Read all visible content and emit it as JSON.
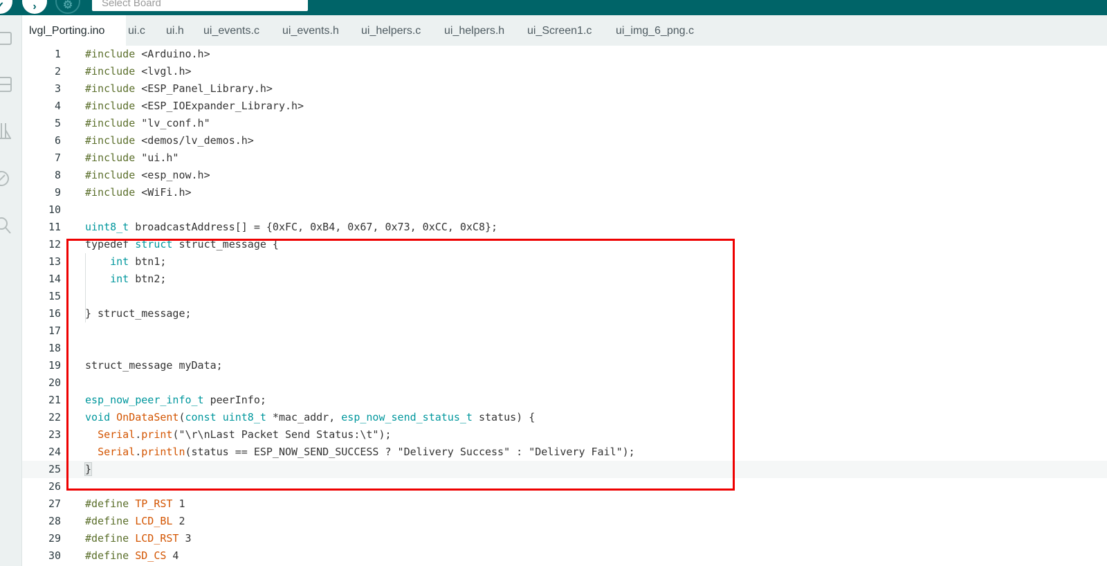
{
  "toolbar": {
    "board_selector_placeholder": "Select Board",
    "verify_icon": "check-icon",
    "upload_icon": "arrow-right-icon",
    "debug_icon": "debug-icon"
  },
  "sidebar": {
    "items": [
      {
        "icon": "folder-icon"
      },
      {
        "icon": "boards-manager-icon"
      },
      {
        "icon": "library-manager-icon"
      },
      {
        "icon": "debug-icon"
      },
      {
        "icon": "search-icon"
      }
    ]
  },
  "tabs": [
    {
      "label": "lvgl_Porting.ino",
      "active": true
    },
    {
      "label": "ui.c"
    },
    {
      "label": "ui.h"
    },
    {
      "label": "ui_events.c"
    },
    {
      "label": "ui_events.h"
    },
    {
      "label": "ui_helpers.c"
    },
    {
      "label": "ui_helpers.h"
    },
    {
      "label": "ui_Screen1.c"
    },
    {
      "label": "ui_img_6_png.c"
    }
  ],
  "editor": {
    "current_line": "25",
    "lines": [
      {
        "n": "1",
        "text": "#include <Arduino.h>"
      },
      {
        "n": "2",
        "text": "#include <lvgl.h>"
      },
      {
        "n": "3",
        "text": "#include <ESP_Panel_Library.h>"
      },
      {
        "n": "4",
        "text": "#include <ESP_IOExpander_Library.h>"
      },
      {
        "n": "5",
        "text": "#include \"lv_conf.h\""
      },
      {
        "n": "6",
        "text": "#include <demos/lv_demos.h>"
      },
      {
        "n": "7",
        "text": "#include \"ui.h\""
      },
      {
        "n": "8",
        "text": "#include <esp_now.h>"
      },
      {
        "n": "9",
        "text": "#include <WiFi.h>"
      },
      {
        "n": "10",
        "text": ""
      },
      {
        "n": "11",
        "text": "uint8_t broadcastAddress[] = {0xFC, 0xB4, 0x67, 0x73, 0xCC, 0xC8};"
      },
      {
        "n": "12",
        "text": "typedef struct struct_message {"
      },
      {
        "n": "13",
        "text": "    int btn1;"
      },
      {
        "n": "14",
        "text": "    int btn2;"
      },
      {
        "n": "15",
        "text": ""
      },
      {
        "n": "16",
        "text": "} struct_message;"
      },
      {
        "n": "17",
        "text": ""
      },
      {
        "n": "18",
        "text": ""
      },
      {
        "n": "19",
        "text": "struct_message myData;"
      },
      {
        "n": "20",
        "text": ""
      },
      {
        "n": "21",
        "text": "esp_now_peer_info_t peerInfo;"
      },
      {
        "n": "22",
        "text": "void OnDataSent(const uint8_t *mac_addr, esp_now_send_status_t status) {"
      },
      {
        "n": "23",
        "text": "  Serial.print(\"\\r\\nLast Packet Send Status:\\t\");"
      },
      {
        "n": "24",
        "text": "  Serial.println(status == ESP_NOW_SEND_SUCCESS ? \"Delivery Success\" : \"Delivery Fail\");"
      },
      {
        "n": "25",
        "text": "}"
      },
      {
        "n": "26",
        "text": ""
      },
      {
        "n": "27",
        "text": "#define TP_RST 1"
      },
      {
        "n": "28",
        "text": "#define LCD_BL 2"
      },
      {
        "n": "29",
        "text": "#define LCD_RST 3"
      },
      {
        "n": "30",
        "text": "#define SD_CS 4"
      }
    ]
  },
  "colors": {
    "toolbar_bg": "#006468",
    "keyword": "#00979d",
    "function": "#d35400",
    "preprocessor": "#5a6e2a",
    "annotation_box": "#ee0000"
  }
}
